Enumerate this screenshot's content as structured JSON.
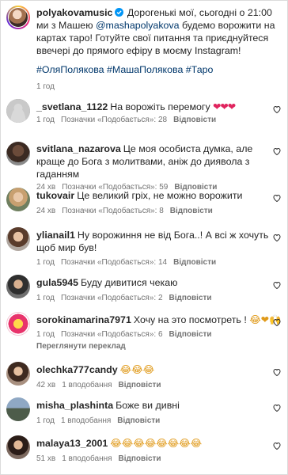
{
  "post": {
    "username": "polyakovamusic",
    "text_1": "Дорогенькі мої, сьогодні о 21:00 ми з Машею",
    "mention": "@mashapolyakova",
    "text_2": "будемо ворожити на картах таро! Готуйте свої питання та приєднуйтеся ввечері до прямого ефіру в моєму Instagram!",
    "hashtags": "#ОляПолякова #МашаПолякова #Таро",
    "time": "1 год"
  },
  "comments": [
    {
      "username": "_svetlana_1122",
      "text": "На ворожіть перемогу",
      "emoji": "❤❤❤",
      "time": "1 год",
      "likes": "Позначки «Подобається»: 28",
      "reply": "Відповісти"
    },
    {
      "username": "svitlana_nazarova",
      "text": "Це моя особиста думка, але краще до Бога з молитвами, аніж до диявола з гаданням",
      "time": "24 хв",
      "likes": "Позначки «Подобається»: 59",
      "reply": "Відповісти"
    },
    {
      "username": "tukovair",
      "text": "Це великий гріх, не можно ворожити",
      "time": "24 хв",
      "likes": "Позначки «Подобається»: 8",
      "reply": "Відповісти"
    },
    {
      "username": "ylianail1",
      "text": "Ну ворожиння не від Бога..! А всі ж хочуть щоб мир був!",
      "time": "1 год",
      "likes": "Позначки «Подобається»: 14",
      "reply": "Відповісти"
    },
    {
      "username": "gula5945",
      "text": "Буду дивитися чекаю",
      "time": "1 год",
      "likes": "Позначки «Подобається»: 2",
      "reply": "Відповісти"
    },
    {
      "username": "sorokinamarina7971",
      "text": "Хочу на это посмотреть !",
      "emoji": "😂❤🙌",
      "time": "1 год",
      "likes": "Позначки «Подобається»: 6",
      "reply": "Відповісти",
      "translate": "Переглянути переклад"
    },
    {
      "username": "olechka777candy",
      "emoji": "😂😂😂",
      "time": "42 хв",
      "likes": "1 вподобання",
      "reply": "Відповісти"
    },
    {
      "username": "misha_plashinta",
      "text": "Боже ви дивні",
      "time": "1 год",
      "likes": "1 вподобання",
      "reply": "Відповісти"
    },
    {
      "username": "malaya13_2001",
      "emoji": "😂😂😂😂😂😂😂😂",
      "time": "51 хв",
      "likes": "1 вподобання",
      "reply": "Відповісти"
    }
  ],
  "icons": {
    "like": "heart-outline-icon",
    "verified": "verified-badge-icon"
  }
}
